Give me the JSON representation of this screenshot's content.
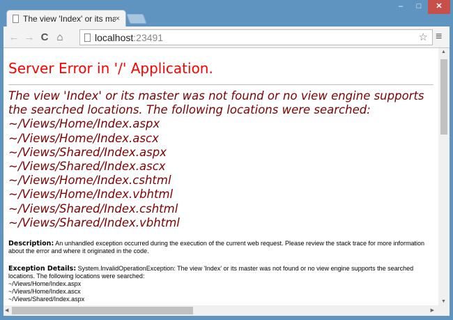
{
  "window": {
    "minimize": "‒",
    "maximize": "□",
    "close": "✕"
  },
  "tab": {
    "title": "The view 'Index' or its mas",
    "close": "×"
  },
  "toolbar": {
    "back": "←",
    "forward": "→",
    "reload": "C",
    "home": "⌂",
    "url_host": "localhost",
    "url_port": ":23491",
    "star": "☆",
    "menu": "≡"
  },
  "page": {
    "title": "Server Error in '/' Application.",
    "error_message": "The view 'Index' or its master was not found or no view engine supports the searched locations. The following locations were searched:",
    "locations": [
      "~/Views/Home/Index.aspx",
      "~/Views/Home/Index.ascx",
      "~/Views/Shared/Index.aspx",
      "~/Views/Shared/Index.ascx",
      "~/Views/Home/Index.cshtml",
      "~/Views/Home/Index.vbhtml",
      "~/Views/Shared/Index.cshtml",
      "~/Views/Shared/Index.vbhtml"
    ],
    "description_label": "Description:",
    "description_text": "An unhandled exception occurred during the execution of the current web request. Please review the stack trace for more information about the error and where it originated in the code.",
    "exception_label": "Exception Details:",
    "exception_text": "System.InvalidOperationException: The view 'Index' or its master was not found or no view engine supports the searched locations. The following locations were searched:",
    "exception_locations": [
      "~/Views/Home/Index.aspx",
      "~/Views/Home/Index.ascx",
      "~/Views/Shared/Index.aspx"
    ]
  }
}
